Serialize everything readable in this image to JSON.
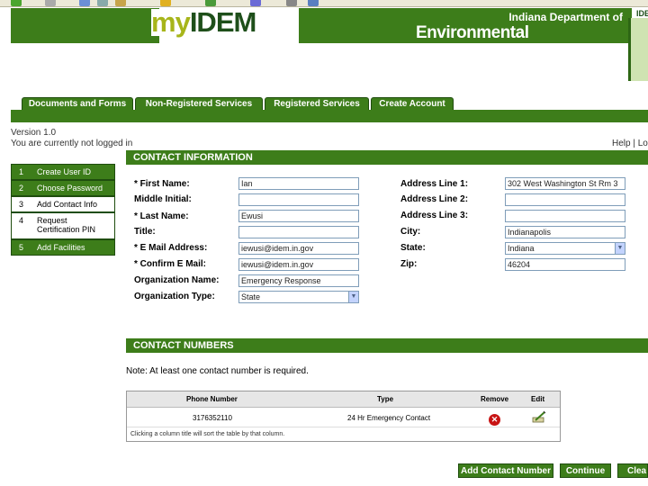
{
  "banner": {
    "logo_my": "my",
    "logo_idem": "IDEM",
    "agency_line1": "Indiana Department of",
    "agency_line2": "Environmental Management",
    "state_badge": "IDE"
  },
  "tabs": [
    {
      "label": "Documents and Forms"
    },
    {
      "label": "Non-Registered Services"
    },
    {
      "label": "Registered Services"
    },
    {
      "label": "Create Account"
    }
  ],
  "status": {
    "version": "Version 1.0",
    "login": "You are currently not logged in",
    "help": "Help | Lo"
  },
  "steps": [
    {
      "num": "1",
      "label": "Create User ID"
    },
    {
      "num": "2",
      "label": "Choose Password"
    },
    {
      "num": "3",
      "label": "Add Contact Info"
    },
    {
      "num": "4",
      "label": "Request Certification PIN"
    },
    {
      "num": "5",
      "label": "Add Facilities"
    }
  ],
  "contact": {
    "heading": "CONTACT INFORMATION",
    "first_name_label": "* First Name:",
    "first_name_value": "Ian",
    "middle_initial_label": "Middle Initial:",
    "middle_initial_value": "",
    "last_name_label": "* Last Name:",
    "last_name_value": "Ewusi",
    "title_label": "Title:",
    "title_value": "",
    "email_label": "* E Mail Address:",
    "email_value": "iewusi@idem.in.gov",
    "confirm_email_label": "* Confirm E Mail:",
    "confirm_email_value": "iewusi@idem.in.gov",
    "org_name_label": "Organization Name:",
    "org_name_value": "Emergency Response",
    "org_type_label": "Organization Type:",
    "org_type_value": "State",
    "addr1_label": "Address Line 1:",
    "addr1_value": "302 West Washington St Rm 3",
    "addr2_label": "Address Line 2:",
    "addr2_value": "",
    "addr3_label": "Address Line 3:",
    "addr3_value": "",
    "city_label": "City:",
    "city_value": "Indianapolis",
    "state_label": "State:",
    "state_value": "Indiana",
    "zip_label": "Zip:",
    "zip_value": "46204"
  },
  "numbers": {
    "heading": "CONTACT NUMBERS",
    "note": "Note: At least one contact number is required.",
    "columns": {
      "phone": "Phone Number",
      "type": "Type",
      "remove": "Remove",
      "edit": "Edit"
    },
    "rows": [
      {
        "phone": "3176352110",
        "type": "24 Hr Emergency Contact"
      }
    ],
    "hint": "Clicking a column title will sort the table by that column."
  },
  "buttons": {
    "add_contact": "Add Contact Number",
    "continue": "Continue",
    "clear": "Clea"
  },
  "colors": {
    "brand_green": "#3d7d1a",
    "logo_lime": "#a7b51a"
  }
}
